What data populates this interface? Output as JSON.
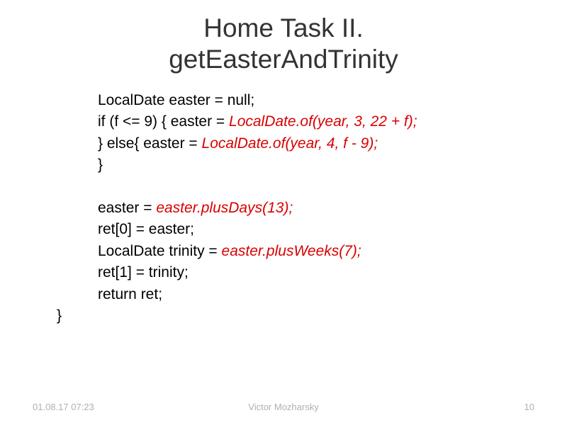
{
  "title_line1": "Home Task II.",
  "title_line2": "getEasterAndTrinity",
  "code": {
    "l1_a": "LocalDate easter = null;",
    "l2_a": "if (f <= 9) { easter = ",
    "l2_b": "LocalDate.of(year, 3, 22 + f);",
    "l3_a": "} else{ easter = ",
    "l3_b": "LocalDate.of(year, 4, f - 9);",
    "l4": "}",
    "l6_a": "easter = ",
    "l6_b": "easter.plusDays(13);",
    "l7": "ret[0] = easter;",
    "l8_a": "LocalDate trinity = ",
    "l8_b": "easter.plusWeeks(7);",
    "l9": "ret[1] = trinity;",
    "l10": "return ret;",
    "l11": "}"
  },
  "footer": {
    "date": "01.08.17 07:23",
    "author": "Victor Mozharsky",
    "page": "10"
  }
}
